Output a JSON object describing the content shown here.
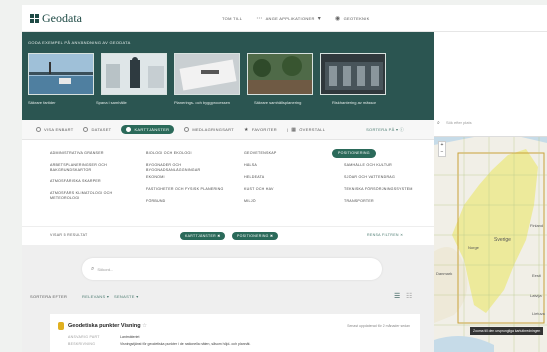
{
  "header": {
    "brand": "Geodata",
    "nav": [
      {
        "label": "TOM TILL",
        "icon": "menu-icon"
      },
      {
        "label": "ANGE APPLIKATIONER",
        "icon": "apps-icon"
      },
      {
        "label": "GEOTEKNIK",
        "icon": "eye-icon"
      }
    ]
  },
  "hero": {
    "title": "GODA EXEMPEL PÅ ANVÄNDNING AV GEODATA",
    "items": [
      {
        "caption": "Säkrare fartider"
      },
      {
        "caption": "Spana i samhälle"
      },
      {
        "caption": "Planerings- och byggprocessen"
      },
      {
        "caption": "Säkrare samhällsplanering"
      },
      {
        "caption": "Riskhantering av mässor"
      }
    ]
  },
  "filters": {
    "options": [
      {
        "label": "VISA ENBART"
      },
      {
        "label": "DATASET"
      },
      {
        "label": "KARTTJÄNSTER"
      },
      {
        "label": "MEDLAGRINGSART"
      },
      {
        "label": "FAVORITER"
      },
      {
        "label": "ÖVERSTALL"
      }
    ],
    "sort_label": "SORTERA PÅ"
  },
  "categories": [
    "ADMINISTRATIVA GRÄNSER",
    "ARBETSPLANERINGSER OCH BAKGRUNDSKARTOR",
    "ATMOSFÄRISKA SKARPER",
    "ATMOSFÄRS KLIMATOLOGI OCH METEOROLOGI",
    "BIOLOGI OCH EKOLOGI",
    "BYGGNADER OCH BYGGNADSANLÄGGNINGAR",
    "EKONOMI",
    "FASTIGHETER OCH FYSISK PLANERING",
    "FÖRBUND",
    "GEOVETENSKAP",
    "HÄLSA",
    "HELDEATA",
    "KUST OCH HAV",
    "MILJÖ",
    "POSITIONERING",
    "SAMHÄLLE OCH KULTUR",
    "SJÖAR OCH VATTENDRAG",
    "TEKNISKA FÖRSÖRJNINGSSYSTEM",
    "TRANSPORTER"
  ],
  "results_bar": {
    "label": "VISAR 5 RESULTAT",
    "tags": [
      "KARTTJÄNSTER",
      "POSITIONERING"
    ],
    "clear": "RENSA FILTREN"
  },
  "search": {
    "placeholder": "Sökord..."
  },
  "sort_row": {
    "label": "SORTERA EFTER",
    "relevance": "RELEVANS",
    "latest": "SENASTE"
  },
  "result": {
    "title": "Geodetiska punkter Visning",
    "updated": "Senast uppdaterad för 2 månader sedan",
    "meta1_label": "ANSVARIG PART",
    "meta1_value": "Lantmäteriet",
    "meta2_label": "BESKRIVNING",
    "meta2_value": "Visningstjänst för geodetiska punkter i de nationella näten, såsom höjd- och plannät."
  },
  "map": {
    "search_placeholder": "Sök efter plats",
    "labels": [
      "Sverige",
      "Finland",
      "Norge",
      "Danmark",
      "Eesti",
      "Latvija",
      "Lietuva"
    ],
    "tooltip": "Zooma till den ursprungliga kartutbredningen"
  }
}
